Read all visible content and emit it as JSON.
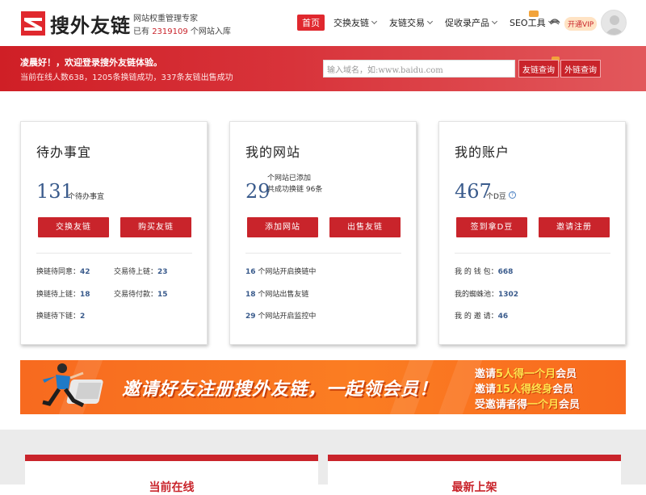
{
  "header": {
    "brand": "搜外友链",
    "tagline": "网站权重管理专家",
    "stat_prefix": "已有",
    "stat_count": "2319109",
    "stat_suffix": "个网站入库",
    "nav": [
      {
        "label": "首页",
        "active": true
      },
      {
        "label": "交换友链",
        "dropdown": true
      },
      {
        "label": "友链交易",
        "dropdown": true
      },
      {
        "label": "促收录产品",
        "dropdown": true
      },
      {
        "label": "SEO工具",
        "dropdown": true
      }
    ],
    "vip_label": "开通VIP"
  },
  "banner": {
    "greeting": "凌晨好！，欢迎登录搜外友链体验。",
    "online_text": "当前在线人数638，1205条换链成功，337条友链出售成功",
    "search_placeholder": "输入域名，如:www.baidu.com",
    "btn_friend": "友链查询",
    "btn_outer": "外链查询"
  },
  "cards": [
    {
      "title": "待办事宜",
      "big": "131",
      "caption": "个待办事宜",
      "buttons": [
        "交换友链",
        "购买友链"
      ],
      "stats": [
        {
          "label": "换链待同意：",
          "value": "42"
        },
        {
          "label": "交易待上链：",
          "value": "23"
        },
        {
          "label": "换链待上链：",
          "value": "18"
        },
        {
          "label": "交易待付款：",
          "value": "15"
        },
        {
          "label": "换链待下链：",
          "value": "2"
        }
      ]
    },
    {
      "title": "我的网站",
      "big": "29",
      "caption1": "个网站已添加",
      "caption2": "共成功换链 96条",
      "buttons": [
        "添加网站",
        "出售友链"
      ],
      "stats": [
        {
          "value": "16",
          "label": " 个网站开启换链中"
        },
        {
          "value": "18",
          "label": " 个网站出售友链"
        },
        {
          "value": "29",
          "label": " 个网站开启监控中"
        }
      ]
    },
    {
      "title": "我的账户",
      "big": "467",
      "caption": "个D豆",
      "buttons": [
        "签到拿D豆",
        "邀请注册"
      ],
      "stats": [
        {
          "label": "我 的 钱 包：",
          "value": "668"
        },
        {
          "label": "我的蜘蛛池：",
          "value": "1302"
        },
        {
          "label": "我 的 邀 请：",
          "value": "46"
        }
      ]
    }
  ],
  "promo": {
    "main": "邀请好友注册搜外友链，一起领会员！",
    "line1": {
      "a": "邀请",
      "b": "5人得",
      "c": "一个月",
      "d": "会员"
    },
    "line2": {
      "a": "邀请",
      "b": "15人得",
      "c": "终身",
      "d": "会员"
    },
    "line3": {
      "a": "受邀请者得",
      "b": "一个月",
      "c": "会员"
    }
  },
  "bottom": {
    "left_title": "当前在线",
    "right_title": "最新上架"
  },
  "colors": {
    "accent": "#c9242b",
    "number": "#3a5b8c",
    "promo": "#fb7d22"
  }
}
